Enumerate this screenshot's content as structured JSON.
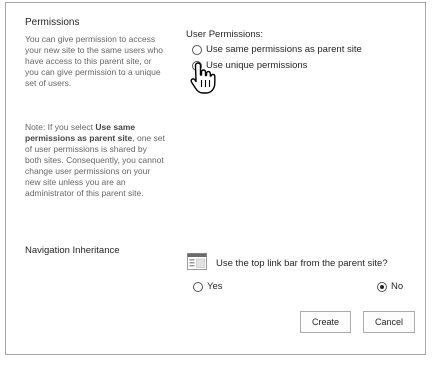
{
  "permissions": {
    "title": "Permissions",
    "description": "You can give permission to access your new site to the same users who have access to this parent site, or you can give permission to a unique set of users.",
    "note": {
      "prefix": "Note: If you select ",
      "bold": "Use same permissions as parent site",
      "suffix": ", one set of user permissions is shared by both sites. Consequently, you cannot change user permissions on your new site unless you are an administrator of this parent site."
    },
    "user_permissions_label": "User Permissions:",
    "options": [
      {
        "label": "Use same permissions as parent site",
        "selected": false
      },
      {
        "label": "Use unique permissions",
        "selected": true
      }
    ]
  },
  "navigation": {
    "title": "Navigation Inheritance",
    "question": "Use the top link bar from the parent site?",
    "yes_label": "Yes",
    "no_label": "No",
    "selected": "No"
  },
  "buttons": {
    "create": "Create",
    "cancel": "Cancel"
  },
  "icons": {
    "cursor": "hand-pointer-icon",
    "linkbar": "top-link-bar-icon"
  }
}
